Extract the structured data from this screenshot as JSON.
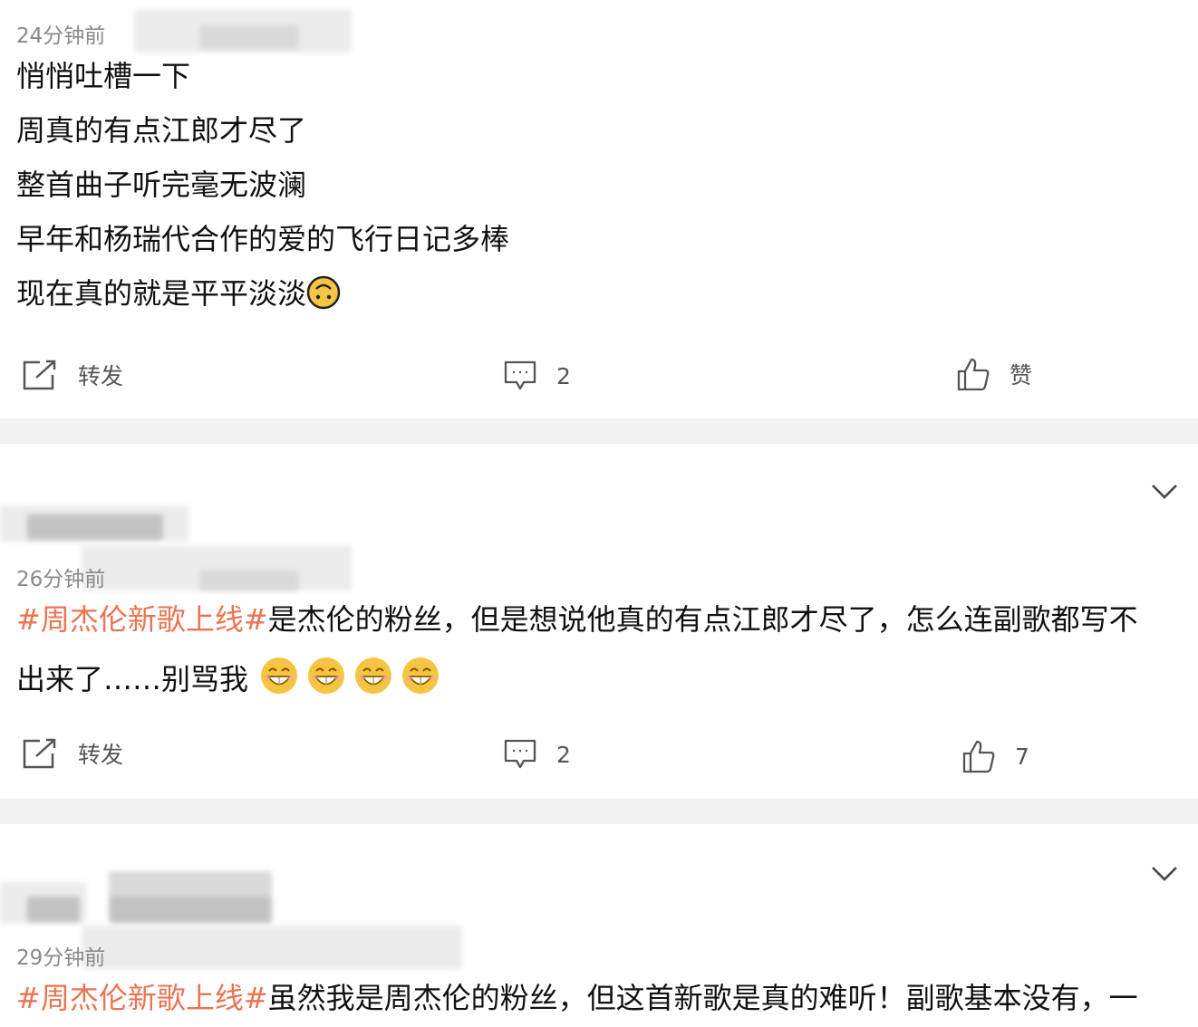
{
  "posts": [
    {
      "time": "24分钟前",
      "lines": [
        "悄悄吐槽一下",
        "周真的有点江郎才尽了",
        "整首曲子听完毫无波澜",
        "早年和杨瑞代合作的爱的飞行日记多棒",
        "现在真的就是平平淡淡"
      ],
      "emoji": "upside-down-face",
      "repost_label": "转发",
      "comment_count": "2",
      "like_label": "赞"
    },
    {
      "time": "26分钟前",
      "topic": "#周杰伦新歌上线#",
      "line1_rest": "是杰伦的粉丝，但是想说他真的有点江郎才尽了，怎么连副歌都写不",
      "line2": "出来了……别骂我",
      "emoji": "grin-face",
      "emoji_count": 4,
      "repost_label": "转发",
      "comment_count": "2",
      "like_count": "7"
    },
    {
      "time": "29分钟前",
      "topic": "#周杰伦新歌上线#",
      "line1_rest": "虽然我是周杰伦的粉丝，但这首新歌是真的难听！副歌基本没有，一"
    }
  ],
  "icons": {
    "repost": "repost-icon",
    "comment": "comment-icon",
    "like": "thumbs-up-icon",
    "expand": "chevron-down-icon"
  },
  "colors": {
    "topic": "#eb7350",
    "divider": "#f2f2f2",
    "icon": "#555555",
    "emoji": "#f5c542"
  }
}
